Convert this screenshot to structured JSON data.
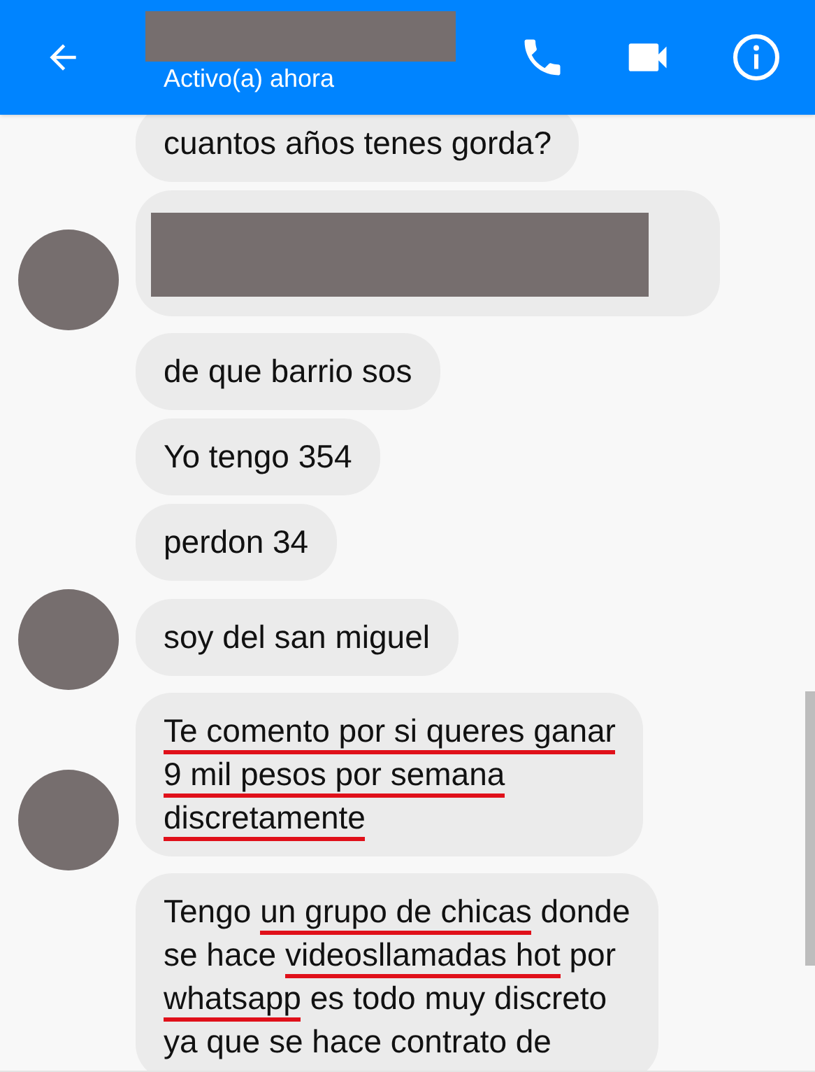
{
  "header": {
    "status": "Activo(a) ahora"
  },
  "messages": [
    {
      "kind": "text",
      "avatar": false,
      "lines": [
        [
          {
            "text": "cuantos años tenes gorda?",
            "underlined": false
          }
        ]
      ]
    },
    {
      "kind": "redacted",
      "avatar": true
    },
    {
      "kind": "text",
      "avatar": false,
      "lines": [
        [
          {
            "text": "de que barrio sos",
            "underlined": false
          }
        ]
      ]
    },
    {
      "kind": "text",
      "avatar": false,
      "lines": [
        [
          {
            "text": "Yo tengo 354",
            "underlined": false
          }
        ]
      ]
    },
    {
      "kind": "text",
      "avatar": false,
      "lines": [
        [
          {
            "text": "perdon 34",
            "underlined": false
          }
        ]
      ]
    },
    {
      "kind": "text",
      "avatar": true,
      "lines": [
        [
          {
            "text": "soy del san miguel",
            "underlined": false
          }
        ]
      ]
    },
    {
      "kind": "text",
      "avatar": true,
      "lines": [
        [
          {
            "text": "Te comento por si queres ganar",
            "underlined": true
          }
        ],
        [
          {
            "text": "9 mil pesos por semana",
            "underlined": true
          }
        ],
        [
          {
            "text": "discretamente",
            "underlined": true
          }
        ]
      ]
    },
    {
      "kind": "text",
      "avatar": false,
      "lines": [
        [
          {
            "text": "Tengo ",
            "underlined": false
          },
          {
            "text": "un grupo de chicas",
            "underlined": true
          },
          {
            "text": " donde",
            "underlined": false
          }
        ],
        [
          {
            "text": "se hace ",
            "underlined": false
          },
          {
            "text": "videosllamadas hot",
            "underlined": true
          },
          {
            "text": " por",
            "underlined": false
          }
        ],
        [
          {
            "text": "whatsapp",
            "underlined": true
          },
          {
            "text": " es todo muy discreto",
            "underlined": false
          }
        ],
        [
          {
            "text": "ya que se hace contrato de",
            "underlined": false
          }
        ]
      ]
    }
  ]
}
